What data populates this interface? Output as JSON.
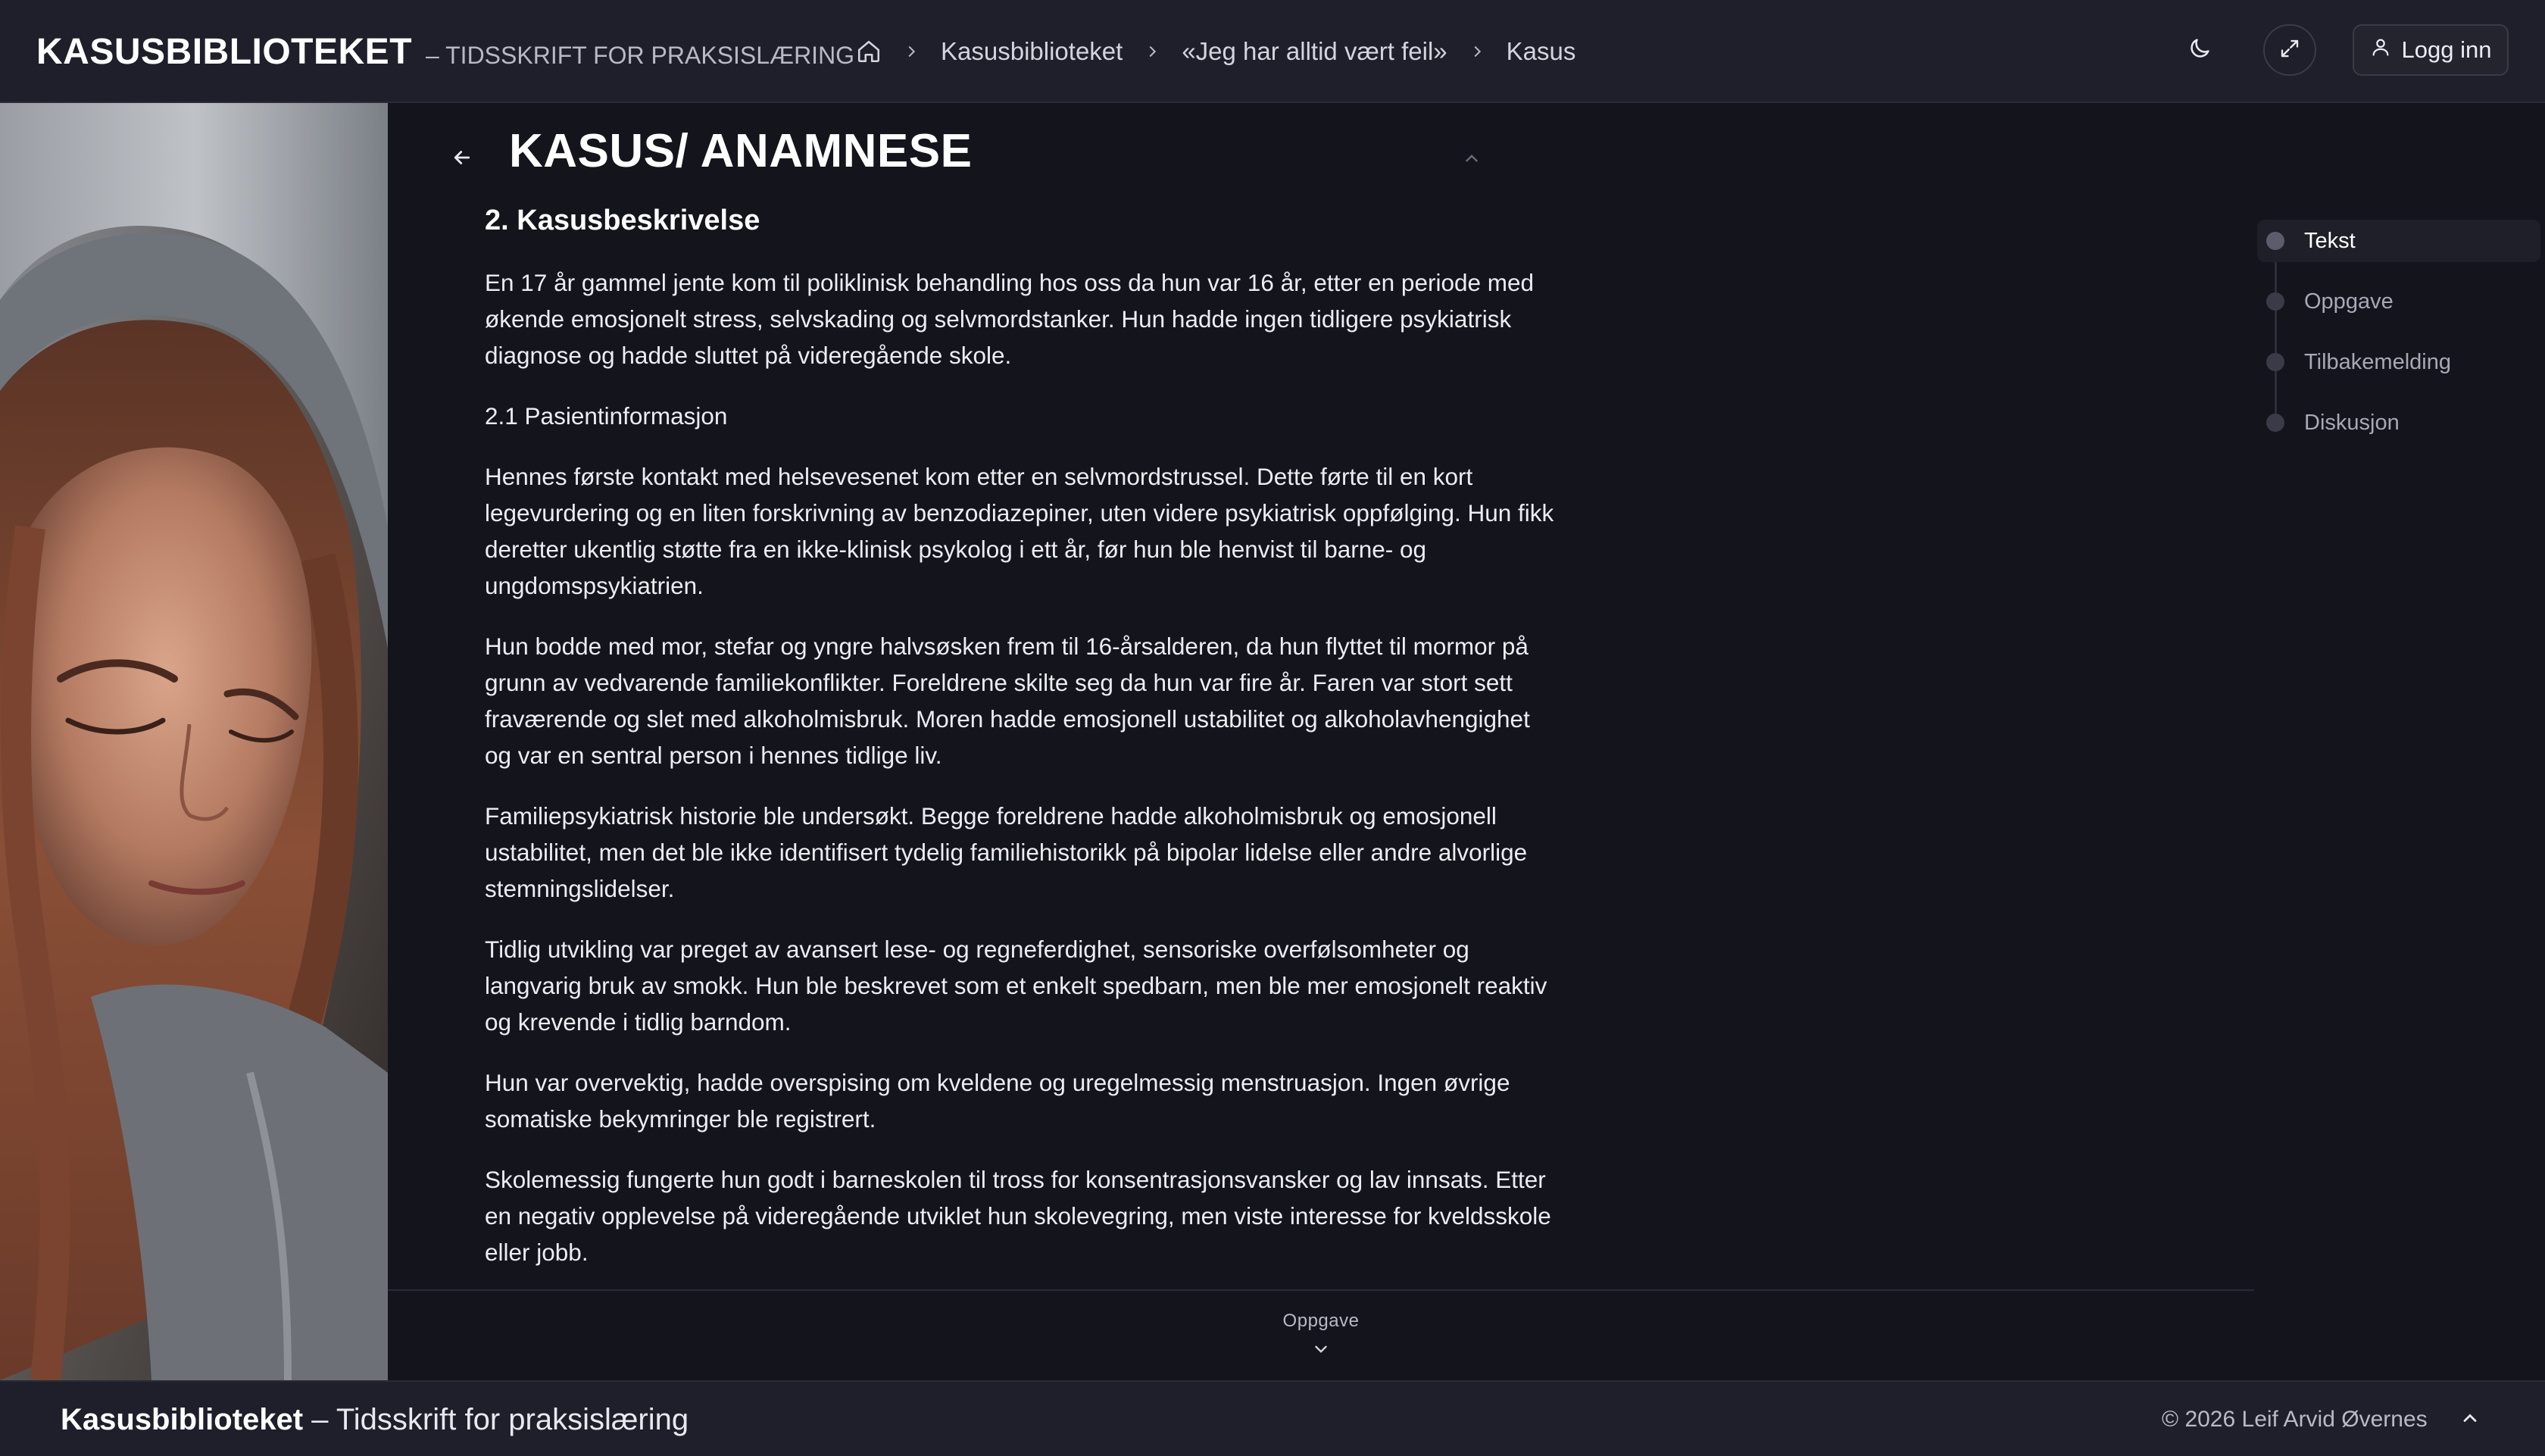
{
  "header": {
    "brand_name": "KASUSBIBLIOTEKET",
    "brand_tagline": "– TIDSSKRIFT FOR PRAKSISLÆRING",
    "breadcrumbs": [
      "Kasusbiblioteket",
      "«Jeg har alltid vært feil»",
      "Kasus"
    ],
    "login_label": "Logg inn"
  },
  "page": {
    "title": "KASUS/ ANAMNESE"
  },
  "article": {
    "section_heading": "2. Kasusbeskrivelse",
    "paragraphs": [
      "En 17 år gammel jente kom til poliklinisk behandling hos oss da hun var 16 år, etter en periode med økende emosjonelt stress, selvskading og selvmordstanker. Hun hadde ingen tidligere psykiatrisk diagnose og hadde sluttet på videregående skole.",
      "2.1 Pasientinformasjon",
      "Hennes første kontakt med helsevesenet kom etter en selvmordstrussel. Dette førte til en kort legevurdering og en liten forskrivning av benzodiazepiner, uten videre psykiatrisk oppfølging. Hun fikk deretter ukentlig støtte fra en ikke-klinisk psykolog i ett år, før hun ble henvist til barne- og ungdomspsykiatrien.",
      "Hun bodde med mor, stefar og yngre halvsøsken frem til 16-årsalderen, da hun flyttet til mormor på grunn av vedvarende familiekonflikter. Foreldrene skilte seg da hun var fire år. Faren var stort sett fraværende og slet med alkoholmisbruk. Moren hadde emosjonell ustabilitet og alkoholavhengighet og var en sentral person i hennes tidlige liv.",
      "Familiepsykiatrisk historie ble undersøkt. Begge foreldrene hadde alkoholmisbruk og emosjonell ustabilitet, men det ble ikke identifisert tydelig familiehistorikk på bipolar lidelse eller andre alvorlige stemningslidelser.",
      "Tidlig utvikling var preget av avansert lese- og regneferdighet, sensoriske overfølsomheter og langvarig bruk av smokk. Hun ble beskrevet som et enkelt spedbarn, men ble mer emosjonelt reaktiv og krevende i tidlig barndom.",
      "Hun var overvektig, hadde overspising om kveldene og uregelmessig menstruasjon. Ingen øvrige somatiske bekymringer ble registrert.",
      "Skolemessig fungerte hun godt i barneskolen til tross for konsentrasjonsvansker og lav innsats. Etter en negativ opplevelse på videregående utviklet hun skolevegring, men viste interesse for kveldsskole eller jobb."
    ]
  },
  "bottom_nav": {
    "next_label": "Oppgave"
  },
  "toc": {
    "items": [
      "Tekst",
      "Oppgave",
      "Tilbakemelding",
      "Diskusjon"
    ],
    "active_index": 0
  },
  "footer": {
    "brand_bold": "Kasusbiblioteket",
    "brand_rest": " – Tidsskrift for praksislæring",
    "copyright": "© 2026 Leif Arvid Øvernes"
  },
  "icons": {
    "home": "home-icon",
    "breadcrumb_separator": "chevron-right-icon",
    "theme_toggle": "moon-icon",
    "fullscreen": "expand-icon",
    "login": "user-icon",
    "back": "arrow-left-icon",
    "collapse": "chevron-up-icon",
    "next_section": "chevron-down-icon",
    "scroll_top": "chevron-up-icon"
  },
  "colors": {
    "background": "#14141c",
    "header": "#1f1f2b",
    "text": "#ececf2",
    "muted": "#a8a8b6"
  }
}
